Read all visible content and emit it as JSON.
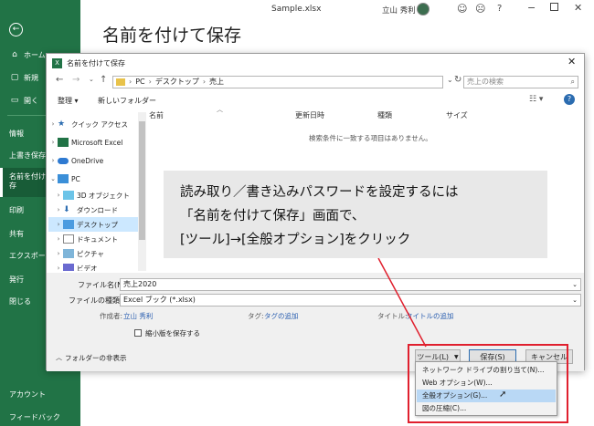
{
  "titlebar": {
    "filename": "Sample.xlsx",
    "user": "立山 秀利"
  },
  "sidebar": {
    "items": [
      "ホーム",
      "新規",
      "開く",
      "情報",
      "上書き保存",
      "名前を付けて保存",
      "印刷",
      "共有",
      "エクスポート",
      "発行",
      "閉じる"
    ],
    "footer": [
      "アカウント",
      "フィードバック"
    ]
  },
  "page_title": "名前を付けて保存",
  "dialog": {
    "title": "名前を付けて保存",
    "breadcrumb": [
      "PC",
      "デスクトップ",
      "売上"
    ],
    "search_placeholder": "売上の検索",
    "toolbar": {
      "organize": "整理 ▾",
      "new_folder": "新しいフォルダー"
    },
    "tree": [
      "クイック アクセス",
      "Microsoft Excel",
      "OneDrive",
      "PC",
      "3D オブジェクト",
      "ダウンロード",
      "デスクトップ",
      "ドキュメント",
      "ピクチャ",
      "ビデオ"
    ],
    "columns": [
      "名前",
      "更新日時",
      "種類",
      "サイズ"
    ],
    "empty_message": "検索条件に一致する項目はありません。",
    "filename_label": "ファイル名(N):",
    "filename_value": "売上2020",
    "filetype_label": "ファイルの種類(T):",
    "filetype_value": "Excel ブック (*.xlsx)",
    "author_label": "作成者:",
    "author_value": "立山 秀利",
    "tags_label": "タグ:",
    "tags_value": "タグの追加",
    "title_label": "タイトル:",
    "title_value": "タイトルの追加",
    "thumbnail_label": "縮小版を保存する",
    "hide_folders": "フォルダーの非表示",
    "tools_button": "ツール(L)",
    "save_button": "保存(S)",
    "cancel_button": "キャンセル"
  },
  "tools_menu": [
    "ネットワーク ドライブの割り当て(N)...",
    "Web オプション(W)...",
    "全般オプション(G)...",
    "図の圧縮(C)..."
  ],
  "callout": {
    "line1": "読み取り／書き込みパスワードを設定するには",
    "line2": "「名前を付けて保存」画面で、",
    "line3": "[ツール]→[全般オプション]をクリック"
  },
  "colors": {
    "excel_green": "#217346",
    "annotation_red": "#e0202e",
    "selection_blue": "#cce8ff",
    "menu_highlight": "#b9d8f5"
  }
}
